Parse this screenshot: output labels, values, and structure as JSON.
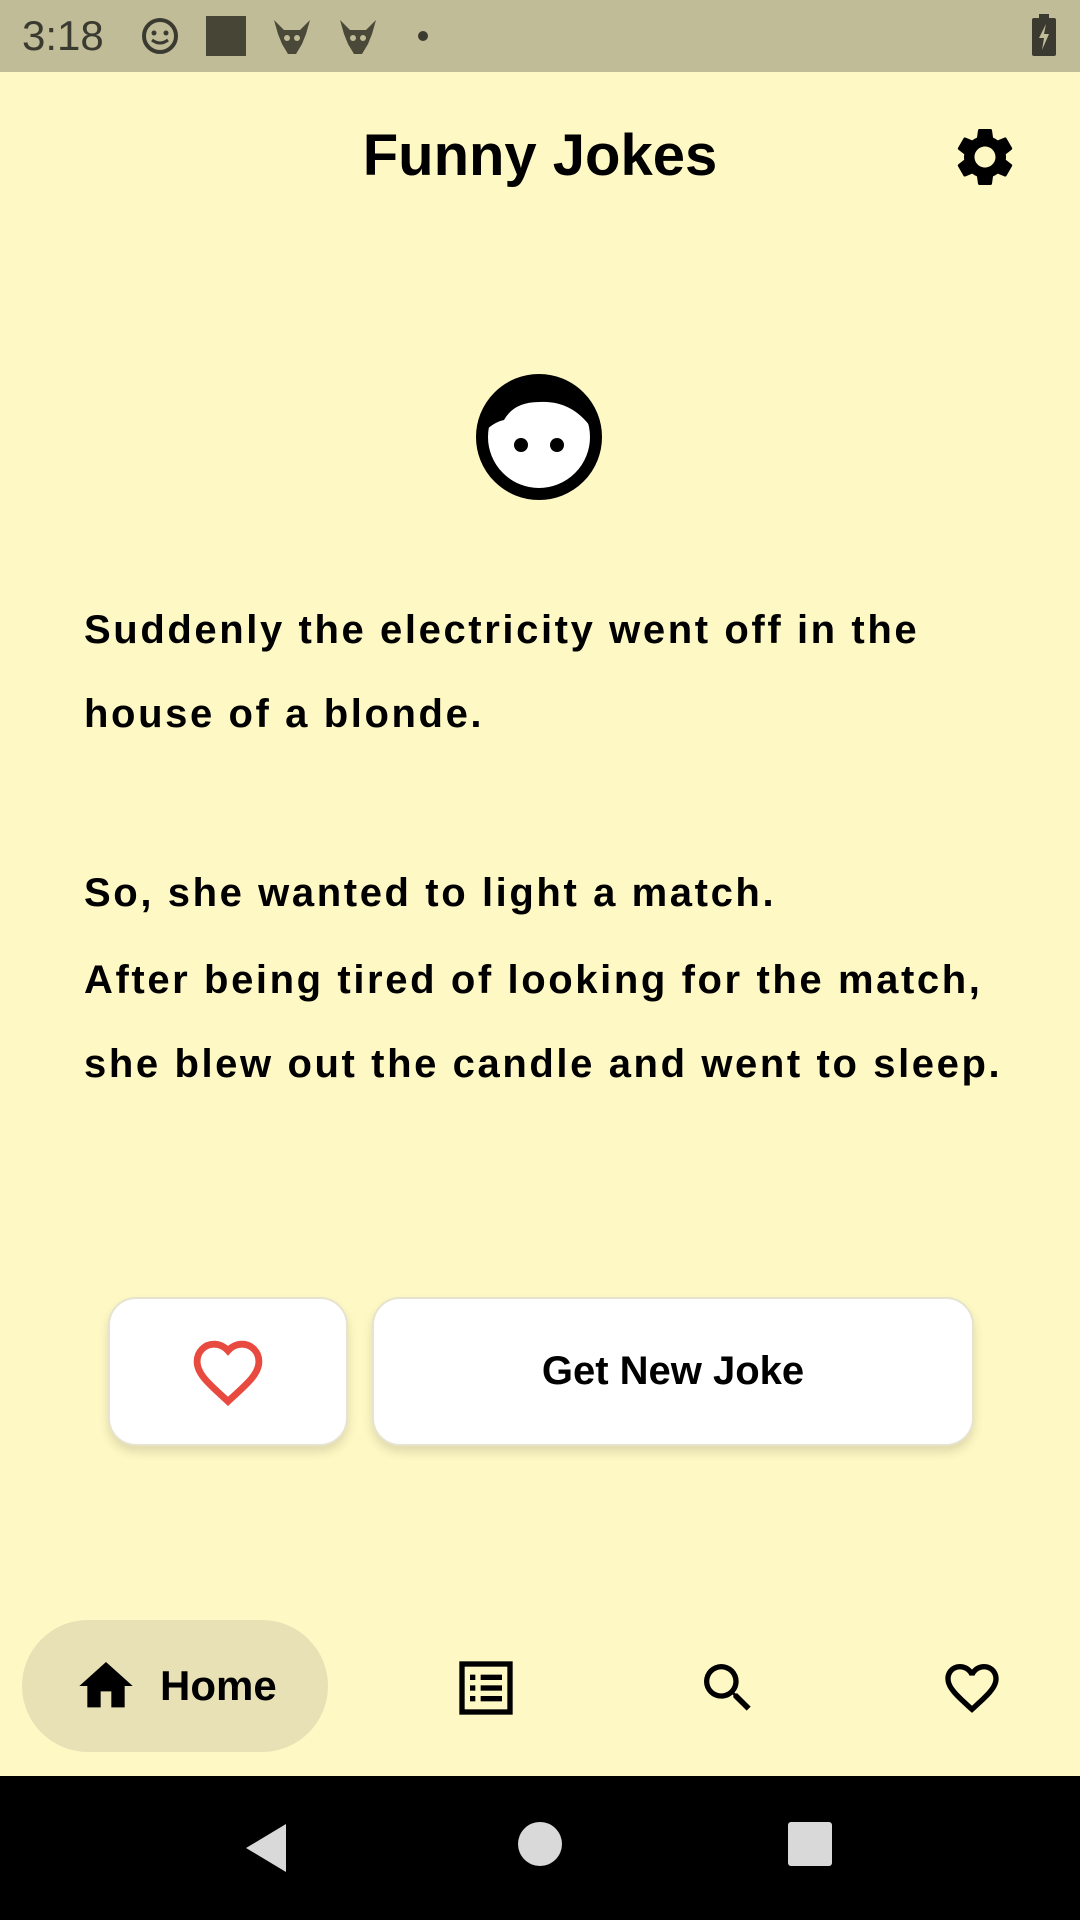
{
  "status_bar": {
    "time": "3:18",
    "icons": [
      "emoji-icon",
      "square-icon",
      "gremlin-icon",
      "gremlin-icon",
      "dot-icon",
      "battery-charging-icon"
    ]
  },
  "header": {
    "title": "Funny Jokes",
    "settings_icon": "gear-icon"
  },
  "joke": {
    "icon": "face-icon",
    "lines": [
      "Suddenly the electricity went off in the house of a blonde.",
      "So, she wanted to light  a match.",
      "After being tired of looking for the match, she blew out the candle and went to sleep."
    ]
  },
  "actions": {
    "favorite_icon": "heart-outline-icon",
    "favorite_color": "#E84A3F",
    "new_joke_label": "Get New Joke"
  },
  "bottom_nav": {
    "active_background": "#E7E1B5",
    "items": [
      {
        "label": "Home",
        "icon": "home-icon",
        "active": true
      },
      {
        "label": "",
        "icon": "list-icon",
        "active": false
      },
      {
        "label": "",
        "icon": "search-icon",
        "active": false
      },
      {
        "label": "",
        "icon": "heart-outline-icon",
        "active": false
      }
    ]
  },
  "system_nav": [
    "back-icon",
    "home-circle-icon",
    "recents-icon"
  ]
}
